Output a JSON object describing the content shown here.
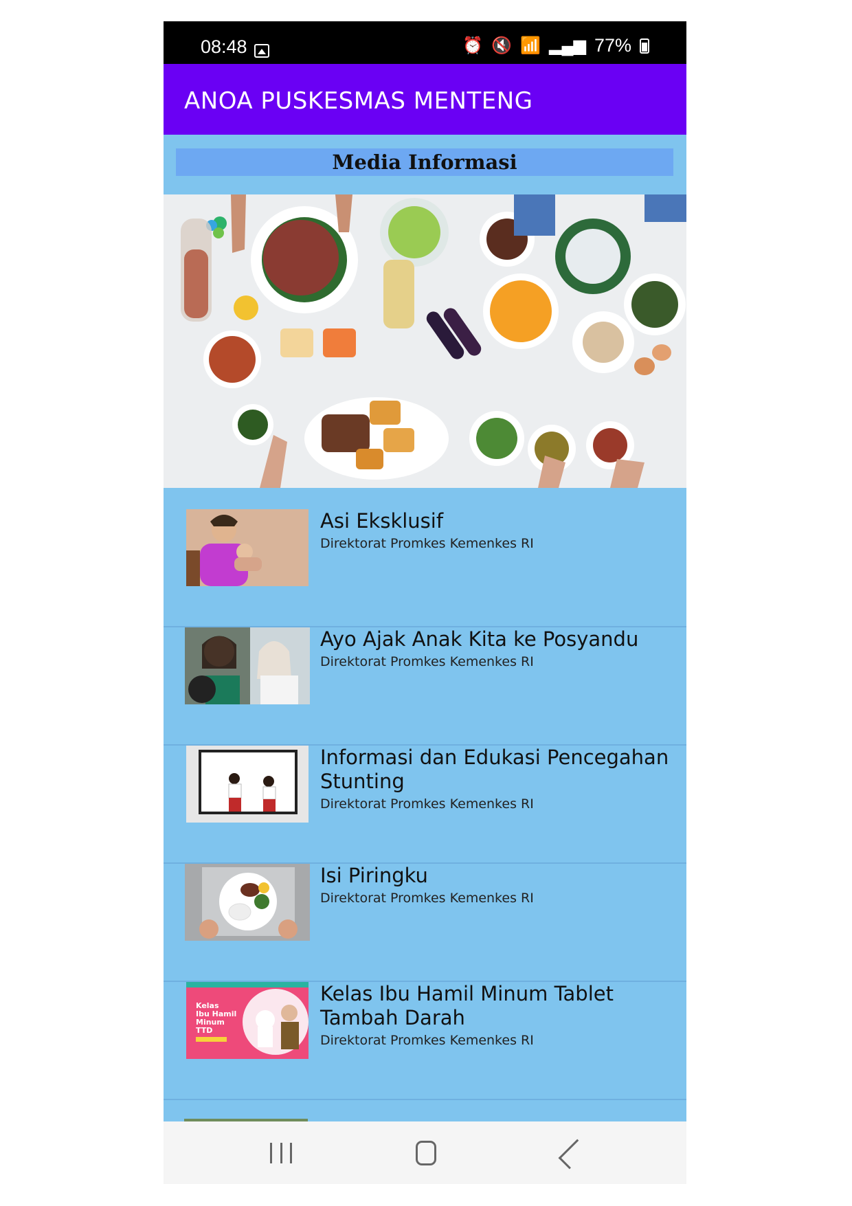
{
  "status_bar": {
    "time": "08:48",
    "battery": "77%"
  },
  "app_bar": {
    "title": "ANOA PUSKESMAS MENTENG"
  },
  "section": {
    "title": "Media Informasi"
  },
  "videos": [
    {
      "title": "Asi Eksklusif",
      "channel": "Direktorat Promkes Kemenkes RI"
    },
    {
      "title": "Ayo Ajak Anak Kita ke Posyandu",
      "channel": "Direktorat Promkes Kemenkes RI"
    },
    {
      "title": "Informasi dan Edukasi Pencegahan Stunting",
      "channel": "Direktorat Promkes Kemenkes RI"
    },
    {
      "title": "Isi Piringku",
      "channel": "Direktorat Promkes Kemenkes RI"
    },
    {
      "title": "Kelas Ibu Hamil Minum Tablet Tambah Darah",
      "channel": "Direktorat Promkes Kemenkes RI"
    }
  ],
  "thumb_texts": {
    "kelas": [
      "Kelas",
      "Ibu Hamil",
      "Minum",
      "TTD"
    ]
  },
  "colors": {
    "app_bar": "#6a00f4",
    "background": "#7fc4ee",
    "section_header": "#6da8f2"
  }
}
